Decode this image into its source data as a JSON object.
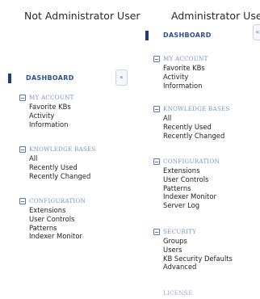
{
  "titles": {
    "left": "Not Administrator User",
    "right": "Administrator User"
  },
  "icons": {
    "collapse": "«"
  },
  "left_panel": {
    "dashboard": "DASHBOARD",
    "sections": [
      {
        "label": "MY ACCOUNT",
        "items": [
          "Favorite KBs",
          "Activity",
          "Information"
        ]
      },
      {
        "label": "KNOWLEDGE BASES",
        "items": [
          "All",
          "Recently Used",
          "Recently Changed"
        ]
      },
      {
        "label": "CONFIGURATION",
        "items": [
          "Extensions",
          "User Controls",
          "Patterns",
          "Indexer Monitor"
        ]
      }
    ]
  },
  "right_panel": {
    "dashboard": "DASHBOARD",
    "sections": [
      {
        "label": "MY ACCOUNT",
        "items": [
          "Favorite KBs",
          "Activity",
          "Information"
        ]
      },
      {
        "label": "KNOWLEDGE BASES",
        "items": [
          "All",
          "Recently Used",
          "Recently Changed"
        ]
      },
      {
        "label": "CONFIGURATION",
        "items": [
          "Extensions",
          "User Controls",
          "Patterns",
          "Indexer Monitor",
          "Server Log"
        ]
      },
      {
        "label": "SECURITY",
        "items": [
          "Groups",
          "Users",
          "KB Security Defaults",
          "Advanced"
        ]
      },
      {
        "label": "LICENSE",
        "items": []
      }
    ]
  }
}
